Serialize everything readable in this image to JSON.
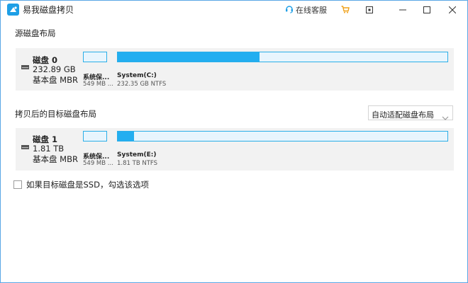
{
  "app": {
    "title": "易我磁盘拷贝"
  },
  "titlebar": {
    "support_label": "在线客服"
  },
  "source": {
    "section_label": "源磁盘布局",
    "disk": {
      "name": "磁盘 0",
      "size": "232.89 GB",
      "type": "基本盘 MBR",
      "partitions": [
        {
          "name": "系统保...",
          "detail": "549 MB ...",
          "used_fraction": 0.0
        },
        {
          "name": "System(C:)",
          "detail": "232.35 GB NTFS",
          "used_fraction": 0.43
        }
      ]
    }
  },
  "target": {
    "section_label": "拷贝后的目标磁盘布局",
    "layout_select": {
      "value": "自动适配磁盘布局"
    },
    "disk": {
      "name": "磁盘 1",
      "size": "1.81 TB",
      "type": "基本盘 MBR",
      "partitions": [
        {
          "name": "系统保...",
          "detail": "549 MB ...",
          "used_fraction": 0.0
        },
        {
          "name": "System(E:)",
          "detail": "1.81 TB NTFS",
          "used_fraction": 0.05
        }
      ]
    }
  },
  "ssd_option": {
    "label": "如果目标磁盘是SSD，勾选该选项",
    "checked": false
  },
  "colors": {
    "accent": "#23aef0",
    "panel": "#f2f2f2",
    "border": "#5aa7e6"
  }
}
